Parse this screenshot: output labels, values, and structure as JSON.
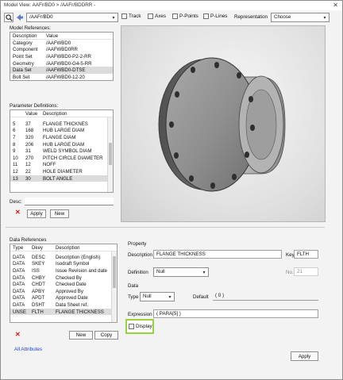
{
  "window": {
    "title": "Model View: AAFr/BD0 > /AAFr/BDDRR -",
    "close_glyph": "✕"
  },
  "toolbar": {
    "element_value": "/AAFr/BD0",
    "checks": [
      {
        "label": "Track",
        "checked": false
      },
      {
        "label": "Axes",
        "checked": false
      },
      {
        "label": "P-Points",
        "checked": false
      },
      {
        "label": "P-Lines",
        "checked": false
      }
    ],
    "representation_label": "Representation",
    "representation_value": "Choose"
  },
  "model_refs": {
    "heading": "Model References:",
    "columns": [
      "Description",
      "Value"
    ],
    "rows": [
      [
        "Category",
        "/AAFWBD0"
      ],
      [
        "Component",
        "/AAFWBD0RR"
      ],
      [
        "Point Set",
        "/AAFWBD0-P2-2-RR"
      ],
      [
        "Geometry",
        "/AAFWBD0-G4-5-RR"
      ],
      [
        "Data Set",
        "/AAFWBD0-DTSE"
      ],
      [
        "Bolt Set",
        "/AAFWBD0-12-20"
      ]
    ],
    "selected_index": 4
  },
  "param_defs": {
    "heading": "Parameter Definitions:",
    "columns": [
      "Number",
      "Value",
      "Description"
    ],
    "rows": [
      [
        "5",
        "37",
        "FLANGE THICKNES"
      ],
      [
        "6",
        "168",
        "HUB LARGE DIAM"
      ],
      [
        "7",
        "320",
        "FLANGE DIAM"
      ],
      [
        "8",
        "206",
        "HUB LARGE DIAM"
      ],
      [
        "9",
        "31",
        "WELD SYMBOL DIAM"
      ],
      [
        "10",
        "270",
        "PITCH CIRCLE DIAMETER"
      ],
      [
        "11",
        "12",
        "NOFF"
      ],
      [
        "12",
        "22",
        "HOLE DIAMETER"
      ],
      [
        "13",
        "30",
        "BOLT ANGLE"
      ]
    ],
    "selected_index": 8
  },
  "desc": {
    "label": "Desc:",
    "value": ""
  },
  "param_buttons": {
    "apply": "Apply",
    "new": "New"
  },
  "data_refs": {
    "heading": "Data References",
    "columns": [
      "Type",
      "Dkey",
      "Description"
    ],
    "rows": [
      [
        "DATA",
        "DESC",
        "Description (English)"
      ],
      [
        "DATA",
        "SKEY",
        "Isodraft Symbol"
      ],
      [
        "DATA",
        "ISS",
        "Issue Revision and date"
      ],
      [
        "DATA",
        "CHBY",
        "Checked By"
      ],
      [
        "DATA",
        "CHDT",
        "Checked Date"
      ],
      [
        "DATA",
        "APBY",
        "Approved By"
      ],
      [
        "DATA",
        "APDT",
        "Approved Date"
      ],
      [
        "DATA",
        "DSHT",
        "Data Sheet ref."
      ],
      [
        "UNSE",
        "FLTH",
        "FLANGE THICKNESS"
      ]
    ],
    "selected_index": 8,
    "new_label": "New",
    "copy_label": "Copy",
    "all_attributes": "All Attributes"
  },
  "property": {
    "heading": "Property",
    "description_label": "Description",
    "description_value": "FLANGE THICKNESS",
    "key_label": "Key",
    "key_value": "FLTH",
    "definition_label": "Definition",
    "definition_value": "Null",
    "no_label": "No.",
    "no_value": "21"
  },
  "data_section": {
    "heading": "Data",
    "type_label": "Type",
    "type_value": "Null",
    "default_label": "Default",
    "default_value": "( 0 )",
    "expression_label": "Expression",
    "expression_value": "( PARA[5] )",
    "display_label": "Display",
    "display_checked": false
  },
  "apply_label": "Apply",
  "icons": [
    "search-icon",
    "navigate-icon",
    "combo-arrow-icon",
    "delete-x-icon",
    "flange-3d-model"
  ],
  "colors": {
    "highlight": "#9bd33b",
    "link": "#1a3fd6",
    "delete": "#dd1111"
  }
}
